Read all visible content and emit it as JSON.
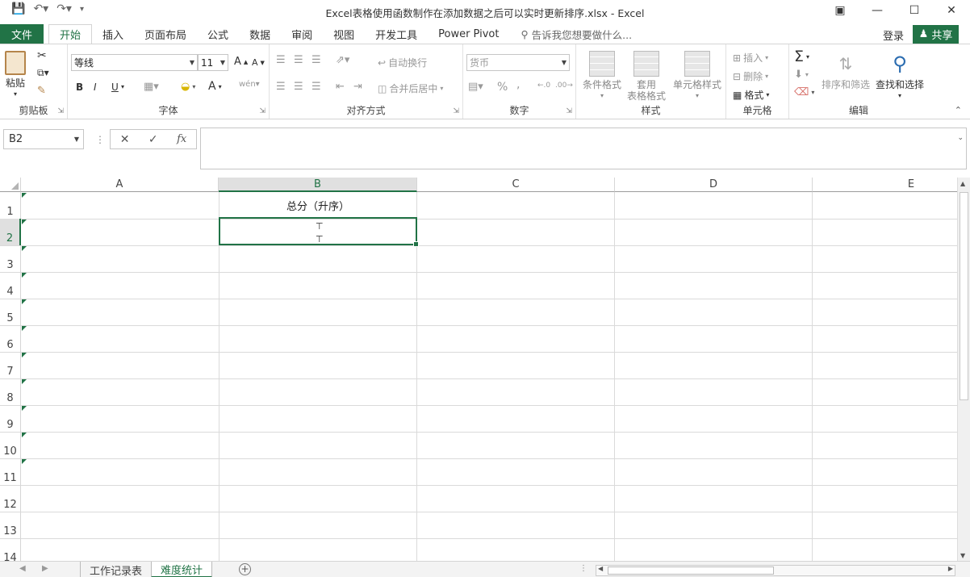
{
  "titlebar": {
    "title": "Excel表格使用函数制作在添加数据之后可以实时更新排序.xlsx - Excel",
    "controls": [
      "ribbon-display",
      "minimize",
      "maximize",
      "close"
    ]
  },
  "tabs": {
    "file": "文件",
    "items": [
      "开始",
      "插入",
      "页面布局",
      "公式",
      "数据",
      "审阅",
      "视图",
      "开发工具",
      "Power Pivot"
    ],
    "active": "开始",
    "tell_me": "告诉我您想要做什么...",
    "sign_in": "登录",
    "share": "共享"
  },
  "ribbon": {
    "clipboard": {
      "paste": "粘贴",
      "label": "剪贴板"
    },
    "font": {
      "name": "等线",
      "size": "11",
      "bold": "B",
      "italic": "I",
      "underline": "U",
      "label": "字体"
    },
    "alignment": {
      "wrap": "自动换行",
      "merge": "合并后居中",
      "label": "对齐方式"
    },
    "number": {
      "format": "货币",
      "percent": "%",
      "comma": ",",
      "label": "数字"
    },
    "styles": {
      "conditional": "条件格式",
      "table_line1": "套用",
      "table_line2": "表格格式",
      "cell_styles": "单元格样式",
      "label": "样式"
    },
    "cells": {
      "insert": "插入",
      "delete": "删除",
      "format": "格式",
      "label": "单元格"
    },
    "editing": {
      "sort_filter": "排序和筛选",
      "find_select": "查找和选择",
      "label": "编辑"
    }
  },
  "formula_bar": {
    "name_box": "B2",
    "fx": "fx",
    "value": ""
  },
  "grid": {
    "columns": [
      "A",
      "B",
      "C",
      "D",
      "E"
    ],
    "selected_column": "B",
    "rows": [
      "1",
      "2",
      "3",
      "4",
      "5",
      "6",
      "7",
      "8",
      "9",
      "10",
      "11",
      "12",
      "13",
      "14"
    ],
    "selected_row": "2",
    "cells": {
      "B1": "总分（升序）"
    },
    "active_cell": "B2"
  },
  "sheets": {
    "tabs": [
      "工作记录表",
      "难度统计"
    ],
    "active": "难度统计"
  },
  "colors": {
    "accent": "#217346"
  }
}
